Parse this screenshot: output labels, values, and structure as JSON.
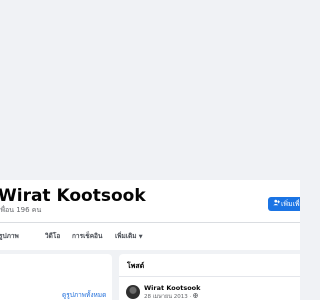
{
  "profile": {
    "name": "Wirat Kootsook",
    "friends_count_text": "เพื่อน 196 คน"
  },
  "actions": {
    "add_friend_label": "เพิ่มเพื่อน"
  },
  "tabs": [
    {
      "label": "รูปภาพ"
    },
    {
      "label": "วิดีโอ"
    },
    {
      "label": "การเช็คอิน"
    },
    {
      "label": "เพิ่มเติม"
    }
  ],
  "photos_panel": {
    "see_all_label": "ดูรูปภาพทั้งหมด"
  },
  "posts_panel": {
    "heading": "โพสต์",
    "post": {
      "author": "Wirat Kootsook",
      "date": "28 เมษายน 2013"
    }
  },
  "colors": {
    "background": "#f0f2f5",
    "accent": "#1b74e4",
    "link": "#216fdb"
  },
  "icons": {
    "add_friend": "add-person-icon",
    "more_tab": "caret-down-icon",
    "privacy": "globe-icon"
  }
}
